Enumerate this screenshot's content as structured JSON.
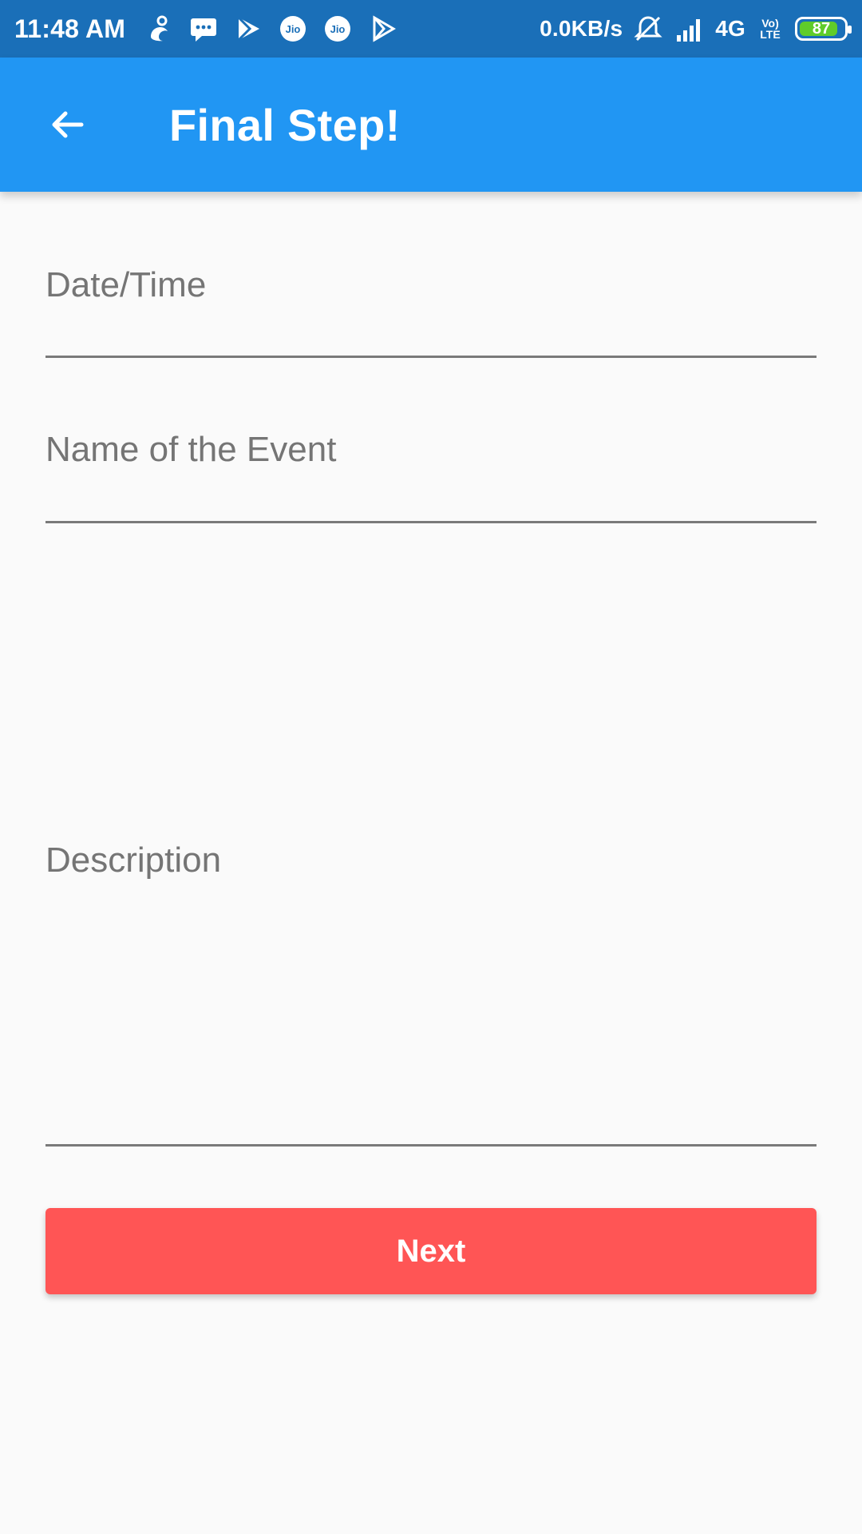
{
  "status_bar": {
    "time": "11:48 AM",
    "icons_left": [
      "uc-browser-icon",
      "message-icon",
      "play-store-icon",
      "jio-icon",
      "jio-icon",
      "play-icon"
    ],
    "network_speed": "0.0KB/s",
    "icons_right": [
      "silent-alarm-icon",
      "signal-icon"
    ],
    "network_type": "4G",
    "volte_label": "Vo) LTE",
    "battery_level": 87,
    "battery_text": "87",
    "colors": {
      "background": "#1a6fb8",
      "battery_fill": "#5fcc2a"
    }
  },
  "app_bar": {
    "title": "Final Step!",
    "back_icon": "arrow-back-icon",
    "color": "#2196f3"
  },
  "form": {
    "fields": [
      {
        "key": "datetime",
        "label": "Date/Time"
      },
      {
        "key": "event_name",
        "label": "Name of the Event"
      },
      {
        "key": "description",
        "label": "Description"
      }
    ],
    "next_button": {
      "label": "Next",
      "color": "#ff5555"
    }
  }
}
